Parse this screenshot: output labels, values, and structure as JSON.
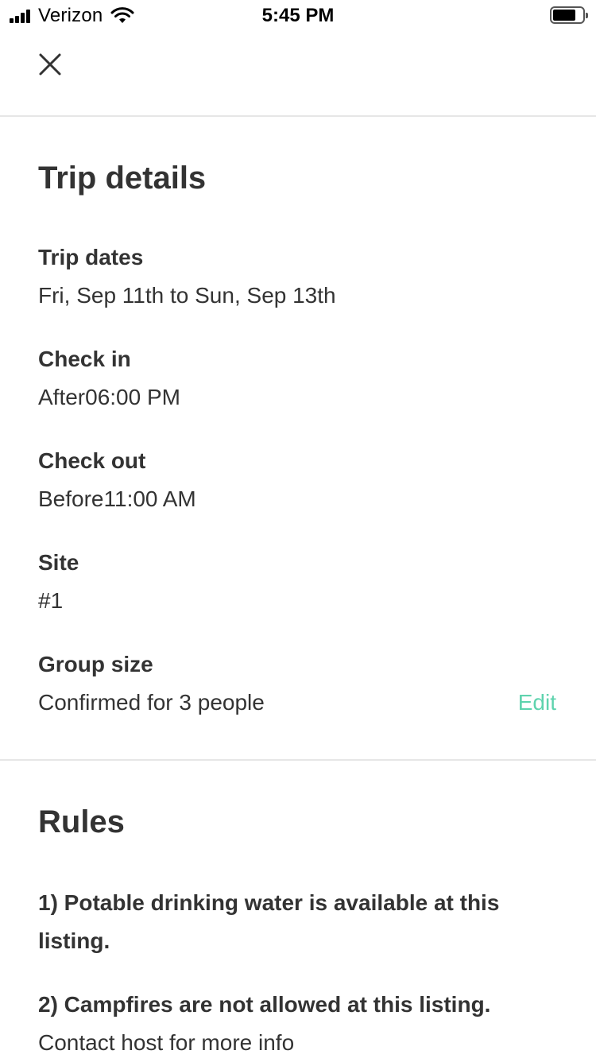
{
  "status_bar": {
    "carrier": "Verizon",
    "time": "5:45 PM"
  },
  "header": {
    "close_icon": "close-icon"
  },
  "trip_details": {
    "title": "Trip details",
    "dates_label": "Trip dates",
    "dates_value": "Fri, Sep 11th to Sun, Sep 13th",
    "checkin_label": "Check in",
    "checkin_value": "After06:00 PM",
    "checkout_label": "Check out",
    "checkout_value": "Before11:00 AM",
    "site_label": "Site",
    "site_value": "#1",
    "group_label": "Group size",
    "group_value": "Confirmed for 3 people",
    "edit_label": "Edit"
  },
  "rules": {
    "title": "Rules",
    "items": [
      {
        "text": "1) Potable drinking water is available at this listing."
      },
      {
        "text": "2) Campfires are not allowed at this listing.",
        "sub": "Contact host for more info"
      }
    ]
  },
  "colors": {
    "accent": "#5fd3ae",
    "text": "#333333",
    "divider": "#e6e6e6"
  }
}
